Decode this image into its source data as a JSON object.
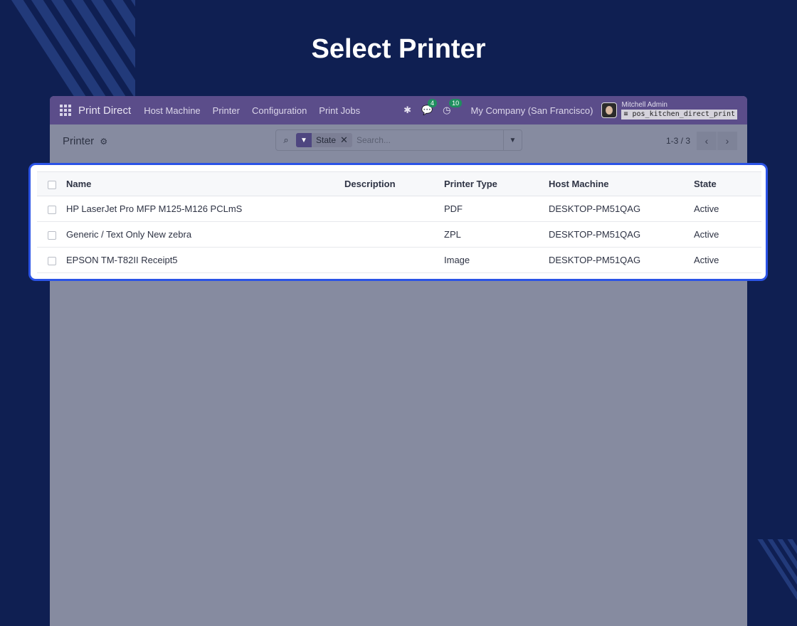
{
  "page_title": "Select Printer",
  "navbar": {
    "app_name": "Print Direct",
    "menu": [
      "Host Machine",
      "Printer",
      "Configuration",
      "Print Jobs"
    ],
    "messages_count": "4",
    "activities_count": "10",
    "company": "My Company (San Francisco)",
    "user_name": "Mitchell Admin",
    "database": "pos_kitchen_direct_print"
  },
  "control_panel": {
    "breadcrumb": "Printer",
    "facet_label": "State",
    "search_placeholder": "Search...",
    "pager_value": "1-3 / 3"
  },
  "table": {
    "headers": {
      "name": "Name",
      "description": "Description",
      "printer_type": "Printer Type",
      "host_machine": "Host Machine",
      "state": "State"
    },
    "rows": [
      {
        "name": "HP LaserJet Pro MFP M125-M126 PCLmS",
        "description": "",
        "printer_type": "PDF",
        "host_machine": "DESKTOP-PM51QAG",
        "state": "Active"
      },
      {
        "name": "Generic / Text Only New zebra",
        "description": "",
        "printer_type": "ZPL",
        "host_machine": "DESKTOP-PM51QAG",
        "state": "Active"
      },
      {
        "name": "EPSON TM-T82II Receipt5",
        "description": "",
        "printer_type": "Image",
        "host_machine": "DESKTOP-PM51QAG",
        "state": "Active"
      }
    ]
  },
  "colors": {
    "background": "#0f1f52",
    "navbar": "#5b4d8a",
    "highlight_border": "#2b53e6"
  }
}
